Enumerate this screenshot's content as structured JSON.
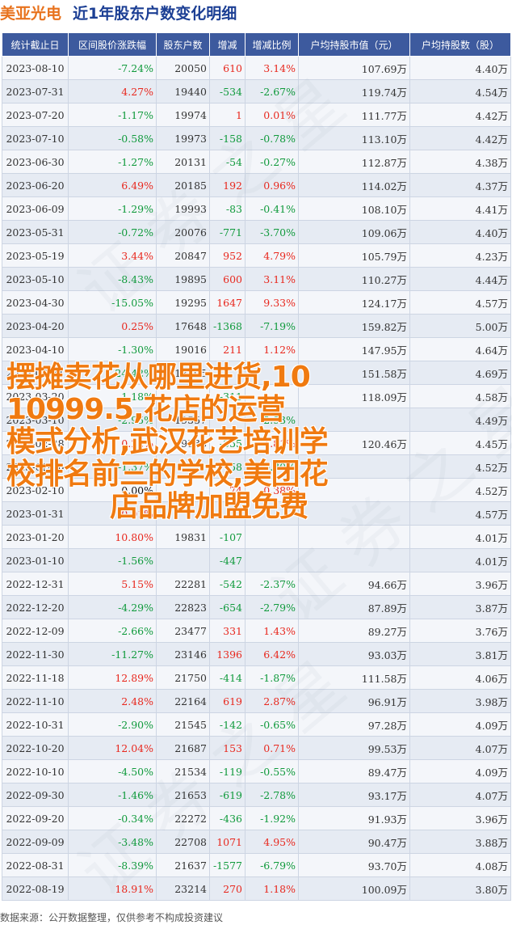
{
  "header": {
    "name": "美亚光电",
    "title": "近1年股东户数变化明细"
  },
  "columns": [
    "统计截止日",
    "区间股价涨跌幅",
    "股东户数",
    "增减",
    "增减比例",
    "户均持股市值（元）",
    "户均持股数（股）"
  ],
  "rows": [
    {
      "date": "2023-08-10",
      "change": "-7.24%",
      "holders": "20050",
      "delta": "610",
      "ratio": "3.14%",
      "value": "107.69万",
      "shares": "4.40万"
    },
    {
      "date": "2023-07-31",
      "change": "4.27%",
      "holders": "19440",
      "delta": "-534",
      "ratio": "-2.67%",
      "value": "119.74万",
      "shares": "4.54万"
    },
    {
      "date": "2023-07-20",
      "change": "-1.17%",
      "holders": "19974",
      "delta": "1",
      "ratio": "0.01%",
      "value": "111.77万",
      "shares": "4.42万"
    },
    {
      "date": "2023-07-10",
      "change": "-0.58%",
      "holders": "19973",
      "delta": "-158",
      "ratio": "-0.78%",
      "value": "113.10万",
      "shares": "4.42万"
    },
    {
      "date": "2023-06-30",
      "change": "-1.27%",
      "holders": "20131",
      "delta": "-54",
      "ratio": "-0.27%",
      "value": "112.87万",
      "shares": "4.38万"
    },
    {
      "date": "2023-06-20",
      "change": "6.49%",
      "holders": "20185",
      "delta": "192",
      "ratio": "0.96%",
      "value": "114.02万",
      "shares": "4.37万"
    },
    {
      "date": "2023-06-09",
      "change": "-1.29%",
      "holders": "19993",
      "delta": "-83",
      "ratio": "-0.41%",
      "value": "108.10万",
      "shares": "4.41万"
    },
    {
      "date": "2023-05-31",
      "change": "-0.72%",
      "holders": "20076",
      "delta": "-771",
      "ratio": "-3.70%",
      "value": "109.06万",
      "shares": "4.40万"
    },
    {
      "date": "2023-05-19",
      "change": "3.44%",
      "holders": "20847",
      "delta": "952",
      "ratio": "4.79%",
      "value": "105.79万",
      "shares": "4.23万"
    },
    {
      "date": "2023-05-10",
      "change": "-8.43%",
      "holders": "19895",
      "delta": "600",
      "ratio": "3.11%",
      "value": "110.27万",
      "shares": "4.44万"
    },
    {
      "date": "2023-04-30",
      "change": "-15.05%",
      "holders": "19295",
      "delta": "1647",
      "ratio": "9.33%",
      "value": "124.17万",
      "shares": "4.57万"
    },
    {
      "date": "2023-04-20",
      "change": "0.25%",
      "holders": "17648",
      "delta": "-1368",
      "ratio": "-7.19%",
      "value": "159.82万",
      "shares": "5.00万"
    },
    {
      "date": "2023-04-10",
      "change": "-1.30%",
      "holders": "19016",
      "delta": "211",
      "ratio": "1.12%",
      "value": "147.95万",
      "shares": "4.64万"
    },
    {
      "date": "2023-03-31",
      "change": "-24.42%",
      "holders": "18805",
      "delta": "",
      "ratio": "",
      "value": "151.58万",
      "shares": "4.69万"
    },
    {
      "date": "2023-03-20",
      "change": "-1.18%",
      "holders": "",
      "delta": "-311",
      "ratio": "",
      "value": "118.09万",
      "shares": "4.58万"
    },
    {
      "date": "2023-03-10",
      "change": "-2.95%",
      "holders": "19557",
      "delta": "",
      "ratio": "-2.93%",
      "value": "",
      "shares": "4.49万"
    },
    {
      "date": "2023-02-28",
      "change": "0.22%",
      "holders": "19338",
      "delta": "-555",
      "ratio": "1.81%",
      "value": "120.46万",
      "shares": "4.45万"
    },
    {
      "date": "2023-02-20",
      "change": "-1.37%",
      "holders": "",
      "delta": "-58",
      "ratio": "-0.30%",
      "value": "",
      "shares": "4.52万"
    },
    {
      "date": "2023-02-10",
      "change": "0.00%",
      "holders": "",
      "delta": "74",
      "ratio": "0.38%",
      "value": "",
      "shares": "4.52万"
    },
    {
      "date": "2023-01-31",
      "change": "0.01%",
      "holders": "",
      "delta": "",
      "ratio": "",
      "value": "",
      "shares": "4.57万"
    },
    {
      "date": "2023-01-20",
      "change": "10.80%",
      "holders": "19831",
      "delta": "-107",
      "ratio": "",
      "value": "",
      "shares": "4.01万"
    },
    {
      "date": "2023-01-10",
      "change": "-1.56%",
      "holders": "",
      "delta": "-447",
      "ratio": "",
      "value": "",
      "shares": "4.01万"
    },
    {
      "date": "2022-12-31",
      "change": "5.15%",
      "holders": "22281",
      "delta": "-542",
      "ratio": "-2.37%",
      "value": "94.66万",
      "shares": "3.96万"
    },
    {
      "date": "2022-12-20",
      "change": "-4.29%",
      "holders": "22823",
      "delta": "-654",
      "ratio": "-2.79%",
      "value": "87.89万",
      "shares": "3.87万"
    },
    {
      "date": "2022-12-09",
      "change": "-2.66%",
      "holders": "23477",
      "delta": "331",
      "ratio": "1.43%",
      "value": "89.27万",
      "shares": "3.76万"
    },
    {
      "date": "2022-11-30",
      "change": "-11.27%",
      "holders": "23146",
      "delta": "1396",
      "ratio": "6.42%",
      "value": "93.03万",
      "shares": "3.81万"
    },
    {
      "date": "2022-11-18",
      "change": "12.89%",
      "holders": "21750",
      "delta": "-414",
      "ratio": "-1.87%",
      "value": "111.58万",
      "shares": "4.06万"
    },
    {
      "date": "2022-11-10",
      "change": "2.48%",
      "holders": "22164",
      "delta": "619",
      "ratio": "2.87%",
      "value": "96.91万",
      "shares": "3.98万"
    },
    {
      "date": "2022-10-31",
      "change": "-2.90%",
      "holders": "21545",
      "delta": "-142",
      "ratio": "-0.65%",
      "value": "97.28万",
      "shares": "4.09万"
    },
    {
      "date": "2022-10-20",
      "change": "12.04%",
      "holders": "21687",
      "delta": "153",
      "ratio": "0.71%",
      "value": "99.53万",
      "shares": "4.07万"
    },
    {
      "date": "2022-10-10",
      "change": "-4.50%",
      "holders": "21534",
      "delta": "-119",
      "ratio": "-0.55%",
      "value": "89.47万",
      "shares": "4.09万"
    },
    {
      "date": "2022-09-30",
      "change": "-1.46%",
      "holders": "21653",
      "delta": "-619",
      "ratio": "-2.78%",
      "value": "93.17万",
      "shares": "4.07万"
    },
    {
      "date": "2022-09-20",
      "change": "-0.34%",
      "holders": "22272",
      "delta": "-436",
      "ratio": "-1.92%",
      "value": "91.93万",
      "shares": "3.96万"
    },
    {
      "date": "2022-09-09",
      "change": "-3.48%",
      "holders": "22708",
      "delta": "1071",
      "ratio": "4.95%",
      "value": "90.47万",
      "shares": "3.88万"
    },
    {
      "date": "2022-08-31",
      "change": "-8.39%",
      "holders": "21637",
      "delta": "-1577",
      "ratio": "-6.79%",
      "value": "93.70万",
      "shares": "4.08万"
    },
    {
      "date": "2022-08-19",
      "change": "18.91%",
      "holders": "23214",
      "delta": "270",
      "ratio": "1.18%",
      "value": "100.09万",
      "shares": "3.80万"
    }
  ],
  "overlay_lines": [
    "摆摊卖花从哪里进货,10",
    "10999.5,花店的运营",
    "模式分析,武汉花艺培训学",
    "校排名前三的学校,美团花",
    "店品牌加盟免费"
  ],
  "footer": "数据来源：公开数据整理，仅供参考不构成投资建议",
  "colors": {
    "header_bg": "#3d5a9e",
    "up": "#e8281e",
    "down": "#109a3c",
    "overlay": "#f07a10",
    "title": "#1c3f94",
    "name": "#e8731e"
  }
}
